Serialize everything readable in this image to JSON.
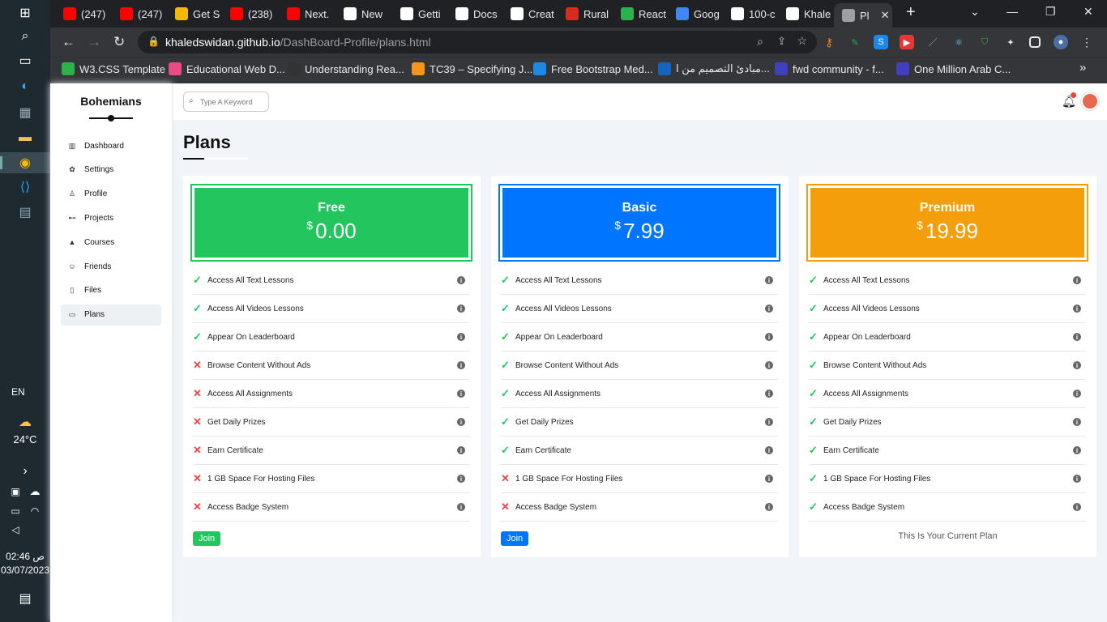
{
  "taskbar": {
    "lang": "EN",
    "weather_temp": "24°C",
    "time": "ص 02:46",
    "date": "03/07/2023"
  },
  "browser": {
    "tabs": [
      {
        "label": "(247)",
        "color": "#ff0000"
      },
      {
        "label": "(247)",
        "color": "#ff0000"
      },
      {
        "label": "Get S",
        "color": "#f5b700"
      },
      {
        "label": "(238)",
        "color": "#ff0000"
      },
      {
        "label": "Next.",
        "color": "#ff0000"
      },
      {
        "label": "New",
        "color": "#ffffff"
      },
      {
        "label": "Getti",
        "color": "#ffffff"
      },
      {
        "label": "Docs",
        "color": "#ffffff"
      },
      {
        "label": "Creat",
        "color": "#ffffff"
      },
      {
        "label": "Rural",
        "color": "#d62d20"
      },
      {
        "label": "React",
        "color": "#2bb24c"
      },
      {
        "label": "Goog",
        "color": "#4285f4"
      },
      {
        "label": "100-c",
        "color": "#ffffff"
      },
      {
        "label": "Khale",
        "color": "#ffffff"
      },
      {
        "label": "Pl",
        "color": "#9aa0a6"
      }
    ],
    "new_tab": "+",
    "url_host": "khaledswidan.github.io",
    "url_path": "/DashBoard-Profile/plans.html",
    "bookmarks": [
      {
        "label": "W3.CSS Template",
        "color": "#2bb24c"
      },
      {
        "label": "Educational Web D...",
        "color": "#ea4c89"
      },
      {
        "label": "Understanding Rea...",
        "color": "#333333"
      },
      {
        "label": "TC39 – Specifying J...",
        "color": "#f7931e"
      },
      {
        "label": "Free Bootstrap Med...",
        "color": "#1e88e5"
      },
      {
        "label": "مبادئ التصميم من ا...",
        "color": "#1565c0"
      },
      {
        "label": "fwd community - f...",
        "color": "#3f3fbf"
      },
      {
        "label": "One Million Arab C...",
        "color": "#3f3fbf"
      }
    ],
    "bookmarks_more": "»"
  },
  "sidebar": {
    "brand": "Bohemians",
    "items": [
      {
        "label": "Dashboard",
        "icon": "chart-icon"
      },
      {
        "label": "Settings",
        "icon": "gear-icon"
      },
      {
        "label": "Profile",
        "icon": "user-icon"
      },
      {
        "label": "Projects",
        "icon": "diagram-icon"
      },
      {
        "label": "Courses",
        "icon": "graduation-cap-icon"
      },
      {
        "label": "Friends",
        "icon": "friends-icon"
      },
      {
        "label": "Files",
        "icon": "file-icon"
      },
      {
        "label": "Plans",
        "icon": "credit-card-icon"
      }
    ]
  },
  "header": {
    "search_placeholder": "Type A Keyword"
  },
  "main": {
    "title": "Plans"
  },
  "plans": [
    {
      "name": "Free",
      "currency": "$",
      "price": "0.00",
      "color": "#22c55e",
      "action": "Join",
      "features": [
        true,
        true,
        true,
        false,
        false,
        false,
        false,
        false,
        false
      ]
    },
    {
      "name": "Basic",
      "currency": "$",
      "price": "7.99",
      "color": "#0075ff",
      "action": "Join",
      "features": [
        true,
        true,
        true,
        true,
        true,
        true,
        true,
        false,
        false
      ]
    },
    {
      "name": "Premium",
      "currency": "$",
      "price": "19.99",
      "color": "#f59e0b",
      "current_text": "This Is Your Current Plan",
      "features": [
        true,
        true,
        true,
        true,
        true,
        true,
        true,
        true,
        true
      ]
    }
  ],
  "feature_labels": [
    "Access All Text Lessons",
    "Access All Videos Lessons",
    "Appear On Leaderboard",
    "Browse Content Without Ads",
    "Access All Assignments",
    "Get Daily Prizes",
    "Earn Certificate",
    "1 GB Space For Hosting Files",
    "Access Badge System"
  ]
}
